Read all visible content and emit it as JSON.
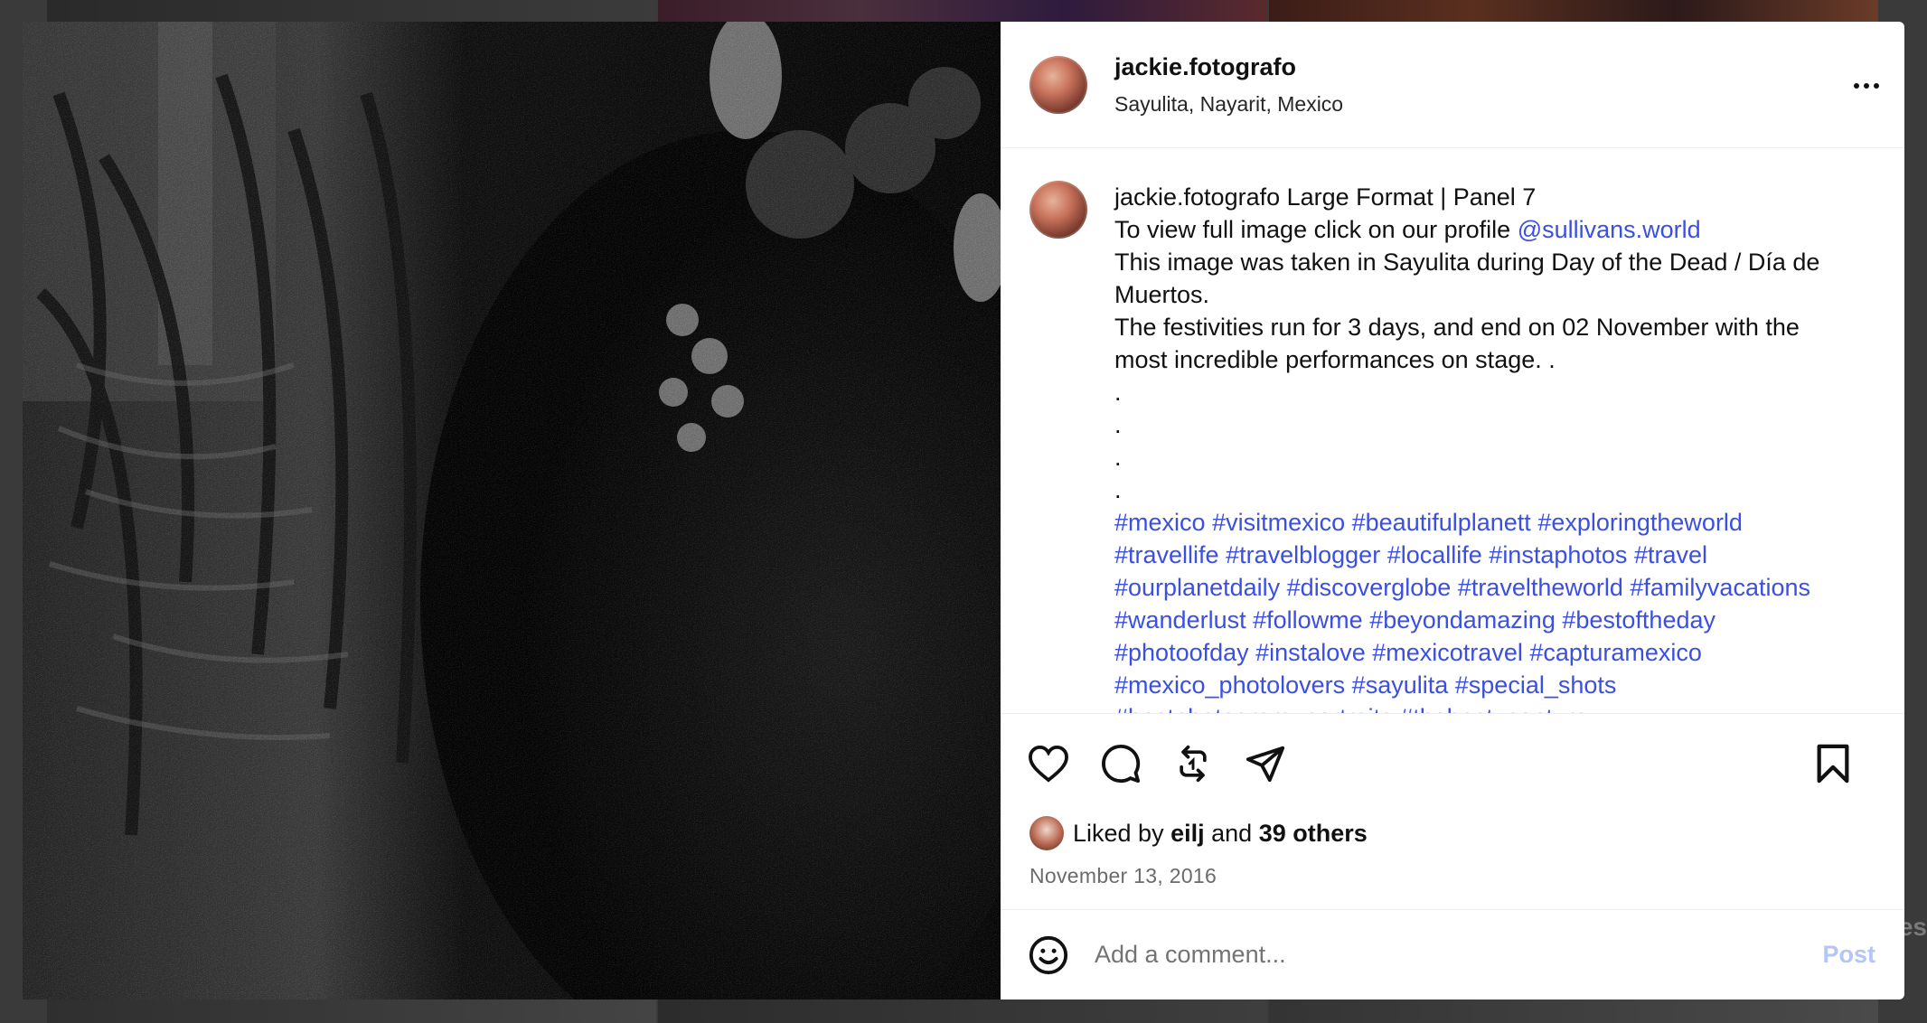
{
  "post": {
    "username": "jackie.fotografo",
    "location": "Sayulita, Nayarit, Mexico",
    "more_icon": "more-horizontal-icon"
  },
  "caption": {
    "username": "jackie.fotografo",
    "title": "Large Format | Panel 7",
    "line_profile_prefix": "To view full image click on our profile ",
    "mention": "@sullivans.world",
    "line_taken": "This image was taken in Sayulita during Day of the Dead / Día de Muertos.",
    "line_festivities": "The festivities run for 3 days, and end on 02 November with the most incredible performances on stage. .",
    "dots": [
      ".",
      ".",
      ".",
      "."
    ],
    "hashtags": [
      "#mexico",
      "#visitmexico",
      "#beautifulplanett",
      "#exploringtheworld",
      "#travellife",
      "#travelblogger",
      "#locallife",
      "#instaphotos",
      "#travel",
      "#ourplanetdaily",
      "#discoverglobe",
      "#traveltheworld",
      "#familyvacations",
      "#wanderlust",
      "#followme",
      "#beyondamazing",
      "#bestoftheday",
      "#photoofday",
      "#instalove",
      "#mexicotravel",
      "#capturamexico",
      "#mexico_photolovers",
      "#sayulita",
      "#special_shots",
      "#bestphotogram_portraits",
      "#thebest_capture"
    ]
  },
  "actions": {
    "like_icon": "heart-icon",
    "comment_icon": "comment-icon",
    "repost_icon": "repost-icon",
    "share_icon": "share-icon",
    "save_icon": "bookmark-icon"
  },
  "likes": {
    "prefix": "Liked by",
    "liker": "eilj",
    "and": "and",
    "others": "39 others"
  },
  "date": "November 13, 2016",
  "comment": {
    "placeholder": "Add a comment...",
    "post_label": "Post",
    "emoji_icon": "smiley-icon"
  },
  "background": {
    "peek_text": "es"
  }
}
